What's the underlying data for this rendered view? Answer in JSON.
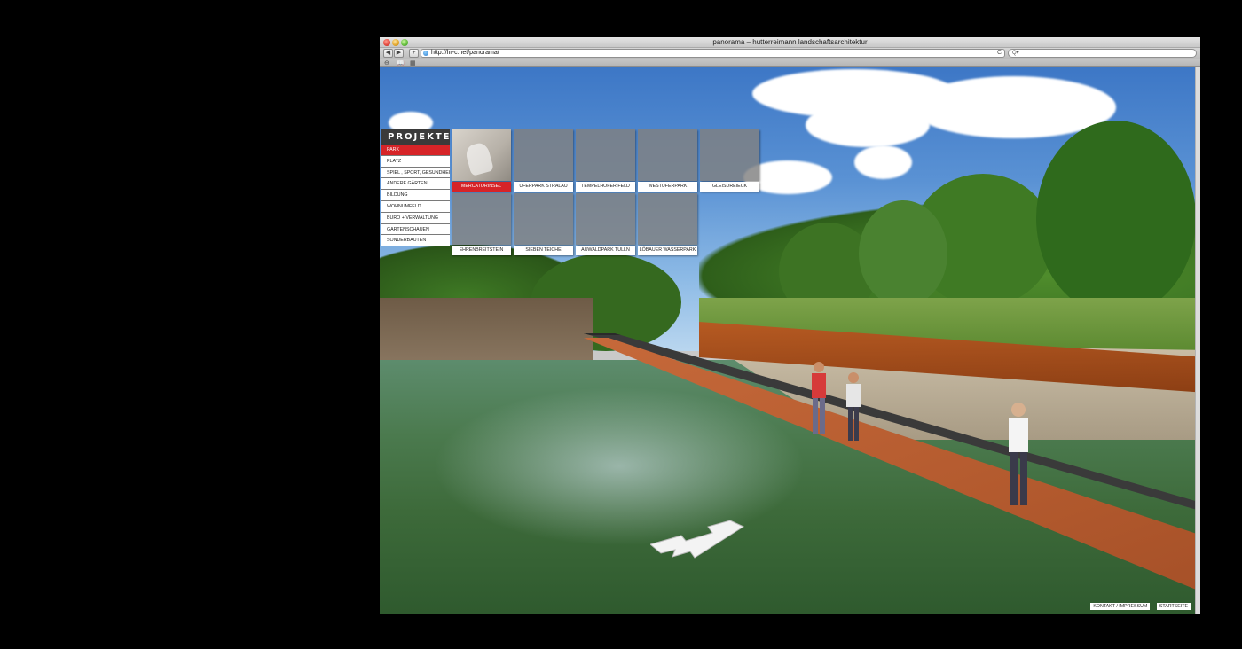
{
  "window": {
    "title": "panorama – hutterreimann landschaftsarchitektur"
  },
  "toolbar": {
    "back_label": "◀",
    "forward_label": "▶",
    "add_label": "+",
    "url": "http://hr-c.net/panorama/",
    "reload_label": "C",
    "search_placeholder": "Q▾"
  },
  "bookmarks": {
    "items": [
      "⊖",
      "📖",
      "▦"
    ]
  },
  "nav": {
    "heading": "PROJEKTE",
    "items": [
      {
        "label": "PARK",
        "active": true
      },
      {
        "label": "PLATZ"
      },
      {
        "label": "SPIEL , SPORT, GESUNDHEIT"
      },
      {
        "label": "ANDERE GÄRTEN"
      },
      {
        "label": "BILDUNG"
      },
      {
        "label": "WOHNUMFELD"
      },
      {
        "label": "BÜRO + VERWALTUNG"
      },
      {
        "label": "GARTENSCHAUEN"
      },
      {
        "label": "SONDERBAUTEN"
      }
    ]
  },
  "projects": {
    "tiles": [
      {
        "label": "MERCATORINSEL",
        "active": true
      },
      {
        "label": "UFERPARK STRALAU"
      },
      {
        "label": "TEMPELHOFER FELD"
      },
      {
        "label": "WESTUFERPARK"
      },
      {
        "label": "GLEISDREIECK"
      },
      {
        "label": "EHRENBREITSTEIN"
      },
      {
        "label": "SIEBEN TEICHE"
      },
      {
        "label": "AUWALDPARK TULLN"
      },
      {
        "label": "LÖBAUER WASSERPARK"
      }
    ]
  },
  "footer": {
    "contact_label": "KONTAKT / IMPRESSUM",
    "home_label": "STARTSEITE"
  },
  "colors": {
    "accent": "#d62428",
    "nav_header": "#3a3a3a"
  }
}
